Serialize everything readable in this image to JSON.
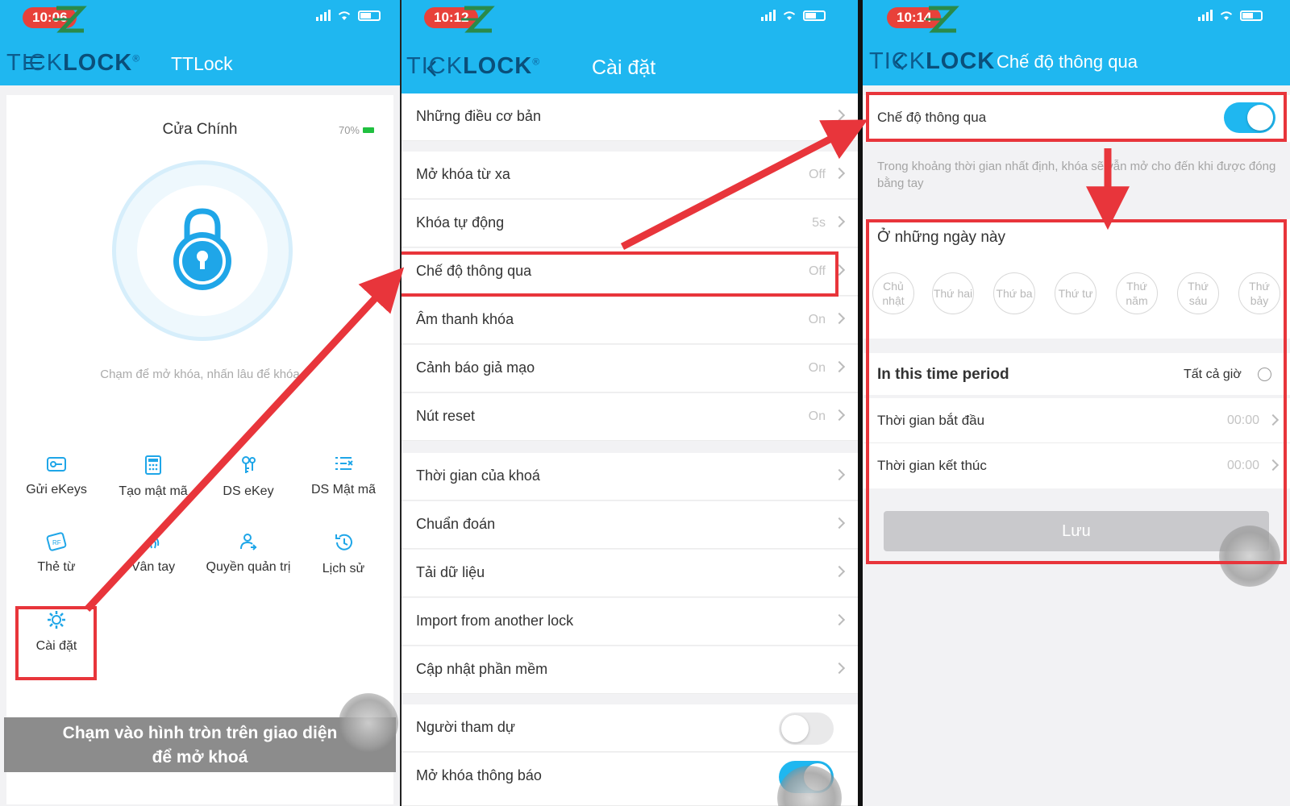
{
  "status": {
    "time1": "10:06",
    "time2": "10:12",
    "time3": "10:14"
  },
  "brand": {
    "prefix": "TI",
    "mid": "CK",
    "suffix": "LOCK",
    "reg": "®"
  },
  "panel1": {
    "header_title": "TTLock",
    "lock_name": "Cửa Chính",
    "battery": "70%",
    "hint": "Chạm để mở khóa, nhấn lâu để khóa",
    "grid": [
      "Gửi eKeys",
      "Tạo mật mã",
      "DS eKey",
      "DS Mật mã",
      "Thẻ từ",
      "Vân tay",
      "Quyền quản trị",
      "Lịch sử",
      "Cài đặt"
    ],
    "caption_line1": "Chạm vào hình tròn trên giao diện",
    "caption_line2": "để mở khoá"
  },
  "panel2": {
    "header_title": "Cài đặt",
    "rows": [
      {
        "label": "Những điều cơ bản",
        "value": ""
      },
      {
        "label": "Mở khóa từ xa",
        "value": "Off"
      },
      {
        "label": "Khóa tự động",
        "value": "5s"
      },
      {
        "label": "Chế độ thông qua",
        "value": "Off"
      },
      {
        "label": "Âm thanh khóa",
        "value": "On"
      },
      {
        "label": "Cảnh báo giả mạo",
        "value": "On"
      },
      {
        "label": "Nút reset",
        "value": "On"
      },
      {
        "label": "Thời gian của khoá",
        "value": ""
      },
      {
        "label": "Chuẩn đoán",
        "value": ""
      },
      {
        "label": "Tải dữ liệu",
        "value": ""
      },
      {
        "label": "Import from another lock",
        "value": ""
      },
      {
        "label": "Cập nhật phần mềm",
        "value": ""
      },
      {
        "label": "Người tham dự",
        "value": ""
      },
      {
        "label": "Mở khóa thông báo",
        "value": ""
      }
    ]
  },
  "panel3": {
    "header_title": "Chế độ thông qua",
    "toggle_label": "Chế độ thông qua",
    "description": "Trong khoảng thời gian nhất định, khóa sẽ vẫn mở cho đến khi được đóng bằng tay",
    "days_title": "Ở những ngày này",
    "days": [
      "Chủ nhật",
      "Thứ hai",
      "Thứ ba",
      "Thứ tư",
      "Thứ năm",
      "Thứ sáu",
      "Thứ bảy"
    ],
    "period_title": "In this time period",
    "all_hours": "Tất cả giờ",
    "start_label": "Thời gian bắt đầu",
    "start_value": "00:00",
    "end_label": "Thời gian kết thúc",
    "end_value": "00:00",
    "save": "Lưu"
  },
  "colors": {
    "header": "#1fb7f0",
    "highlight": "#e8353b",
    "toggle_on": "#1fb7f0"
  }
}
